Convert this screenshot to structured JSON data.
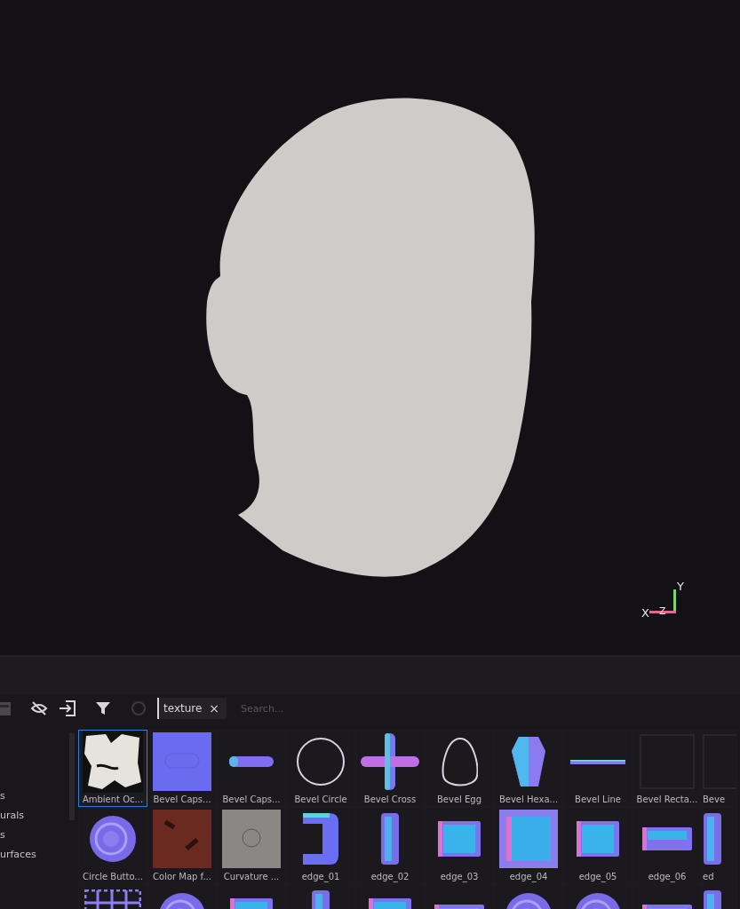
{
  "viewport": {
    "axis_labels": {
      "x": "X",
      "z": "Z",
      "y": "Y"
    }
  },
  "toolbar": {
    "filter_tag": {
      "label": "texture",
      "close": "×"
    },
    "search": {
      "placeholder": "Search..."
    }
  },
  "sidebar": {
    "items": [
      "s",
      "urals",
      "s",
      "urfaces"
    ]
  },
  "assets": {
    "rows": [
      [
        {
          "label": "Ambient Oc...",
          "kind": "ao",
          "selected": true
        },
        {
          "label": "Bevel Caps...",
          "kind": "square",
          "selected": false
        },
        {
          "label": "Bevel Caps...",
          "kind": "capsule",
          "selected": false
        },
        {
          "label": "Bevel Circle",
          "kind": "ring",
          "selected": false
        },
        {
          "label": "Bevel Cross",
          "kind": "cross",
          "selected": false
        },
        {
          "label": "Bevel Egg",
          "kind": "egg",
          "selected": false
        },
        {
          "label": "Bevel Hexa...",
          "kind": "gem",
          "selected": false
        },
        {
          "label": "Bevel Line",
          "kind": "line",
          "selected": false
        },
        {
          "label": "Bevel Recta...",
          "kind": "outline",
          "selected": false
        },
        {
          "label": "Beve",
          "kind": "outline",
          "selected": false
        }
      ],
      [
        {
          "label": "Circle Butto...",
          "kind": "button",
          "selected": false
        },
        {
          "label": "Color Map f...",
          "kind": "colormap",
          "selected": false
        },
        {
          "label": "Curvature ...",
          "kind": "curvature",
          "selected": false
        },
        {
          "label": "edge_01",
          "kind": "bracket",
          "selected": false
        },
        {
          "label": "edge_02",
          "kind": "bar",
          "selected": false
        },
        {
          "label": "edge_03",
          "kind": "edge",
          "selected": false
        },
        {
          "label": "edge_04",
          "kind": "edgebig",
          "selected": false
        },
        {
          "label": "edge_05",
          "kind": "edge",
          "selected": false
        },
        {
          "label": "edge_06",
          "kind": "flat",
          "selected": false
        },
        {
          "label": "ed",
          "kind": "bar",
          "selected": false
        }
      ],
      [
        {
          "kind": "grid",
          "selected": false
        },
        {
          "kind": "button",
          "selected": false
        },
        {
          "kind": "edge",
          "selected": false
        },
        {
          "kind": "bar",
          "selected": false
        },
        {
          "kind": "edge",
          "selected": false
        },
        {
          "kind": "flat",
          "selected": false
        },
        {
          "kind": "button",
          "selected": false
        },
        {
          "kind": "button",
          "selected": false
        },
        {
          "kind": "flat",
          "selected": false
        },
        {
          "kind": "bar",
          "selected": false
        }
      ]
    ]
  }
}
